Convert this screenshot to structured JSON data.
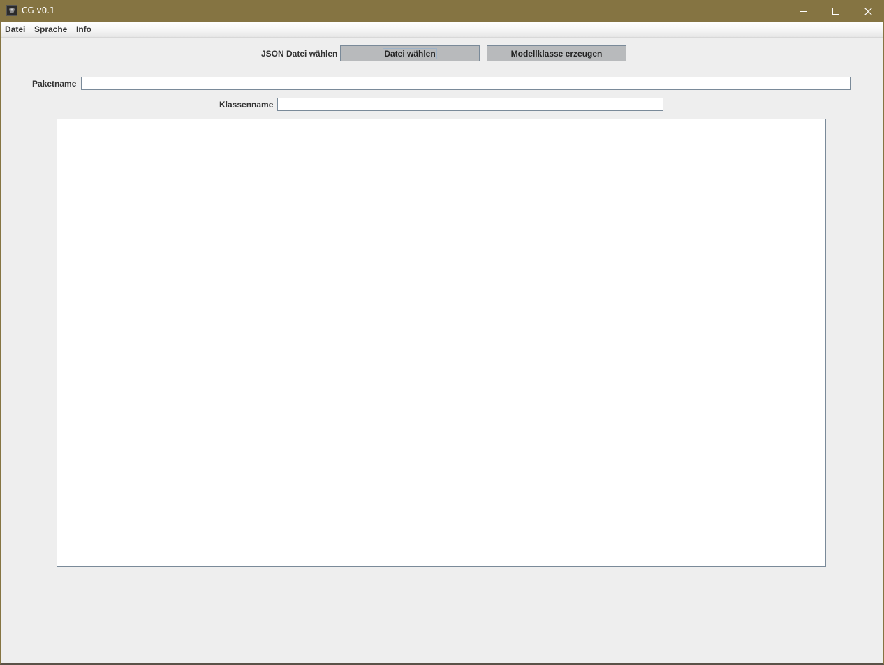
{
  "window": {
    "title": "CG v0.1",
    "controls": {
      "minimize": "minimize-icon",
      "maximize": "maximize-icon",
      "close": "close-icon"
    }
  },
  "menu": {
    "items": [
      {
        "label": "Datei"
      },
      {
        "label": "Sprache"
      },
      {
        "label": "Info"
      }
    ]
  },
  "form": {
    "json_label": "JSON Datei wählen",
    "choose_button": "Datei wählen",
    "generate_button": "Modellklasse erzeugen",
    "package_label": "Paketname",
    "package_value": "",
    "class_label": "Klassenname",
    "class_value": "",
    "output_value": ""
  },
  "colors": {
    "titlebar": "#857442",
    "background": "#eeeeee",
    "button": "#b8babc",
    "border": "#7a8a99"
  }
}
